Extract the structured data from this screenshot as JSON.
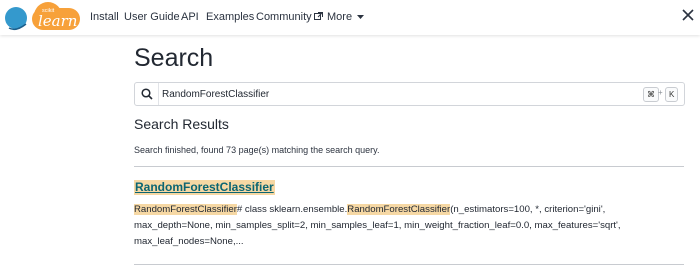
{
  "brand": {
    "logo_small_text": "scikit",
    "logo_text": "learn",
    "colors": {
      "orange": "#f7a13a",
      "blue": "#3499cd",
      "dark_blue": "#1c5f8c"
    }
  },
  "nav": {
    "install": "Install",
    "user_guide": "User Guide",
    "api": "API",
    "examples": "Examples",
    "community": "Community",
    "more": "More"
  },
  "page": {
    "title": "Search"
  },
  "search": {
    "value": "RandomForestClassifier",
    "shortcut_cmd": "⌘",
    "shortcut_plus": "+",
    "shortcut_key": "K"
  },
  "results": {
    "heading": "Search Results",
    "summary": "Search finished, found 73 page(s) matching the search query.",
    "items": [
      {
        "title": "RandomForestClassifier",
        "snippet_highlight_1": "RandomForestClassifier",
        "snippet_text_1": "# class sklearn.ensemble.",
        "snippet_highlight_2": "RandomForestClassifier",
        "snippet_text_2": "(n_estimators=100, *, criterion='gini', max_depth=None, min_samples_split=2, min_samples_leaf=1, min_weight_fraction_leaf=0.0, max_features='sqrt', max_leaf_nodes=None,..."
      }
    ]
  },
  "colors": {
    "highlight": "#f6d8a4",
    "link": "#0b6572",
    "text": "#222832"
  }
}
